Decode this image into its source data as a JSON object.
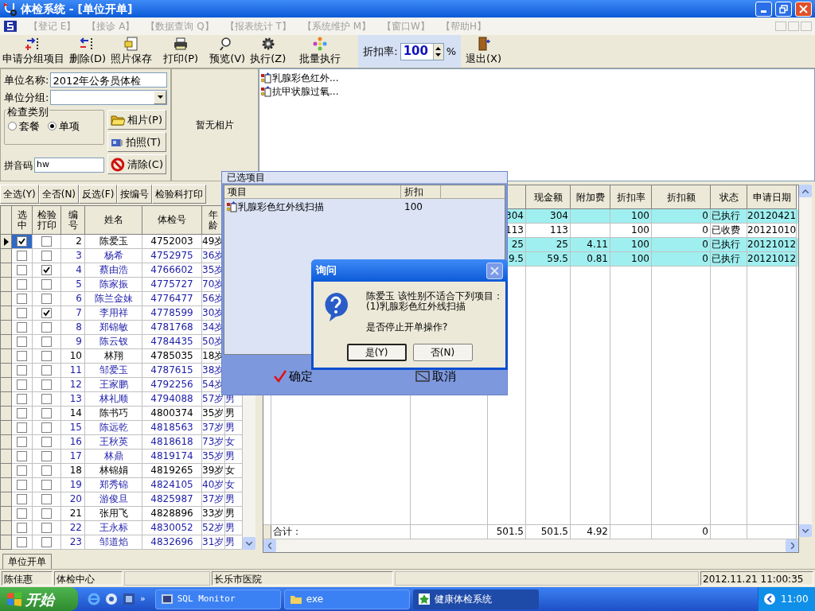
{
  "window": {
    "title": "体检系统 - [单位开单]"
  },
  "menu": [
    {
      "label": "【登记 E】",
      "disabled": true
    },
    {
      "label": "【接诊 A】",
      "disabled": true
    },
    {
      "label": "【数据查询 Q】",
      "disabled": true
    },
    {
      "label": "【报表统计 T】",
      "disabled": true
    },
    {
      "label": "【系统维护 M】",
      "disabled": true
    },
    {
      "label": "【窗口W】",
      "disabled": true
    },
    {
      "label": "【帮助H】",
      "disabled": true
    }
  ],
  "toolbar": {
    "buttons": [
      {
        "label": "申请分组项目",
        "kind": "add"
      },
      {
        "label": "删除(D)",
        "kind": "remove"
      },
      {
        "label": "照片保存",
        "kind": "photo"
      },
      {
        "label": "打印(P)",
        "kind": "print"
      },
      {
        "label": "预览(V)",
        "kind": "preview"
      },
      {
        "label": "执行(Z)",
        "kind": "execute"
      },
      {
        "label": "批量执行",
        "kind": "batch"
      }
    ],
    "discount": {
      "label": "折扣率:",
      "value": "100",
      "unit": "%"
    },
    "exit": {
      "label": "退出(X)"
    }
  },
  "unit_form": {
    "name_label": "单位名称:",
    "name_value": "2012年公务员体检",
    "group_label": "单位分组:",
    "category_legend": "检查类别",
    "radios": [
      {
        "label": "套餐",
        "selected": false
      },
      {
        "label": "单项",
        "selected": true
      }
    ],
    "pinyin_label": "拼音码",
    "pinyin_value": "hw"
  },
  "photo_buttons": [
    {
      "label": "相片(P)",
      "kind": "folder"
    },
    {
      "label": "拍照(T)",
      "kind": "camera"
    },
    {
      "label": "清除(C)",
      "kind": "clear"
    }
  ],
  "photo": {
    "text": "暂无相片"
  },
  "item_list": [
    "乳腺彩色红外...",
    "抗甲状腺过氧..."
  ],
  "select_buttons": [
    "全选(Y)",
    "全否(N)",
    "反选(F)",
    "按编号",
    "检验科打印"
  ],
  "people_table": {
    "columns": [
      "选中",
      "检验打印",
      "编号",
      "姓名",
      "体检号",
      "年龄"
    ],
    "rows": [
      {
        "current": true,
        "checked": true,
        "print": false,
        "no": "2",
        "name": "陈爱玉",
        "exam_no": "4752003",
        "age": "49岁",
        "color": "#000000"
      },
      {
        "current": false,
        "checked": false,
        "print": false,
        "no": "3",
        "name": "杨希",
        "exam_no": "4752975",
        "age": "36岁",
        "color": "#1c1ca8"
      },
      {
        "current": false,
        "checked": false,
        "print": true,
        "no": "4",
        "name": "蔡由浩",
        "exam_no": "4766602",
        "age": "35岁",
        "color": "#1c1ca8"
      },
      {
        "current": false,
        "checked": false,
        "print": false,
        "no": "5",
        "name": "陈家振",
        "exam_no": "4775727",
        "age": "70岁",
        "color": "#1c1ca8"
      },
      {
        "current": false,
        "checked": false,
        "print": false,
        "no": "6",
        "name": "陈兰金妹",
        "exam_no": "4776477",
        "age": "56岁",
        "color": "#1c1ca8"
      },
      {
        "current": false,
        "checked": false,
        "print": true,
        "no": "7",
        "name": "李用祥",
        "exam_no": "4778599",
        "age": "30岁",
        "color": "#1c1ca8"
      },
      {
        "current": false,
        "checked": false,
        "print": false,
        "no": "8",
        "name": "郑锦敏",
        "exam_no": "4781768",
        "age": "34岁",
        "color": "#1c1ca8"
      },
      {
        "current": false,
        "checked": false,
        "print": false,
        "no": "9",
        "name": "陈云钗",
        "exam_no": "4784435",
        "age": "50岁",
        "color": "#1c1ca8"
      },
      {
        "current": false,
        "checked": false,
        "print": false,
        "no": "10",
        "name": "林翔",
        "exam_no": "4785035",
        "age": "18岁",
        "color": "#000000"
      },
      {
        "current": false,
        "checked": false,
        "print": false,
        "no": "11",
        "name": "邹爱玉",
        "exam_no": "4787615",
        "age": "38岁",
        "color": "#1c1ca8"
      },
      {
        "current": false,
        "checked": false,
        "print": false,
        "no": "12",
        "name": "王家鹏",
        "exam_no": "4792256",
        "age": "54岁",
        "color": "#1c1ca8"
      },
      {
        "current": false,
        "checked": false,
        "print": false,
        "no": "13",
        "name": "林礼顺",
        "exam_no": "4794088",
        "age": "57岁",
        "sex": "男",
        "color": "#1c1ca8"
      },
      {
        "current": false,
        "checked": false,
        "print": false,
        "no": "14",
        "name": "陈书巧",
        "exam_no": "4800374",
        "age": "35岁",
        "sex": "男",
        "color": "#000000"
      },
      {
        "current": false,
        "checked": false,
        "print": false,
        "no": "15",
        "name": "陈远乾",
        "exam_no": "4818563",
        "age": "37岁",
        "sex": "男",
        "color": "#1c1ca8"
      },
      {
        "current": false,
        "checked": false,
        "print": false,
        "no": "16",
        "name": "王秋英",
        "exam_no": "4818618",
        "age": "73岁",
        "sex": "女",
        "color": "#1c1ca8"
      },
      {
        "current": false,
        "checked": false,
        "print": false,
        "no": "17",
        "name": "林鼎",
        "exam_no": "4819174",
        "age": "35岁",
        "sex": "男",
        "color": "#1c1ca8"
      },
      {
        "current": false,
        "checked": false,
        "print": false,
        "no": "18",
        "name": "林锦娟",
        "exam_no": "4819265",
        "age": "39岁",
        "sex": "女",
        "color": "#000000"
      },
      {
        "current": false,
        "checked": false,
        "print": false,
        "no": "19",
        "name": "郑秀锦",
        "exam_no": "4824105",
        "age": "40岁",
        "sex": "女",
        "color": "#1c1ca8"
      },
      {
        "current": false,
        "checked": false,
        "print": false,
        "no": "20",
        "name": "游俊旦",
        "exam_no": "4825987",
        "age": "37岁",
        "sex": "男",
        "color": "#1c1ca8"
      },
      {
        "current": false,
        "checked": false,
        "print": false,
        "no": "21",
        "name": "张用飞",
        "exam_no": "4828896",
        "age": "33岁",
        "sex": "男",
        "color": "#000000"
      },
      {
        "current": false,
        "checked": false,
        "print": false,
        "no": "22",
        "name": "王永标",
        "exam_no": "4830052",
        "age": "52岁",
        "sex": "男",
        "color": "#1c1ca8"
      },
      {
        "current": false,
        "checked": false,
        "print": false,
        "no": "23",
        "name": "邹道焰",
        "exam_no": "4832696",
        "age": "31岁",
        "sex": "男",
        "color": "#1c1ca8"
      }
    ]
  },
  "fee_table": {
    "columns": [
      "现金额",
      "附加费",
      "折扣率",
      "折扣额",
      "状态",
      "申请日期"
    ],
    "rows": [
      {
        "highlighted": true,
        "amount": "304",
        "cash": "304",
        "rate": "100",
        "discount": "0",
        "status": "已执行",
        "date": "20120421"
      },
      {
        "highlighted": false,
        "amount": "113",
        "cash": "113",
        "rate": "100",
        "discount": "0",
        "status": "已收费",
        "date": "20121010"
      },
      {
        "highlighted": true,
        "amount": "25",
        "cash": "25",
        "extra": "4.11",
        "rate": "100",
        "discount": "0",
        "status": "已执行",
        "date": "20121012"
      },
      {
        "highlighted": true,
        "amount": "9.5",
        "cash": "59.5",
        "extra": "0.81",
        "rate": "100",
        "discount": "0",
        "status": "已执行",
        "date": "20121012"
      }
    ],
    "total": {
      "label": "合计：",
      "amount": "501.5",
      "cash": "501.5",
      "extra": "4.92",
      "discount": "0"
    }
  },
  "selected_items_window": {
    "title": "已选项目",
    "columns": [
      "项目",
      "折扣"
    ],
    "rows": [
      {
        "item": "乳腺彩色红外线扫描",
        "discount": "100"
      }
    ],
    "buttons": [
      {
        "label": "确定",
        "kind": "ok"
      },
      {
        "label": "取消",
        "kind": "cancel"
      }
    ]
  },
  "dialog": {
    "title": "询问",
    "message_lines": [
      "陈爱玉 该性别不适合下列项目：",
      "(1)乳腺彩色红外线扫描"
    ],
    "question": "是否停止开单操作?",
    "buttons": [
      "是(Y)",
      "否(N)"
    ]
  },
  "tabs": [
    {
      "label": "单位开单",
      "selected": true
    }
  ],
  "status_bar": [
    "陈佳惠",
    "体检中心",
    "长乐市医院",
    "2012.11.21 11:00:35"
  ],
  "taskbar": {
    "start": "开始",
    "more": "»",
    "tasks": [
      {
        "label": "SQL Monitor",
        "selected": false
      },
      {
        "label": "exe",
        "selected": false
      },
      {
        "label": "健康体检系统",
        "selected": true
      }
    ],
    "clock": "11:00"
  }
}
